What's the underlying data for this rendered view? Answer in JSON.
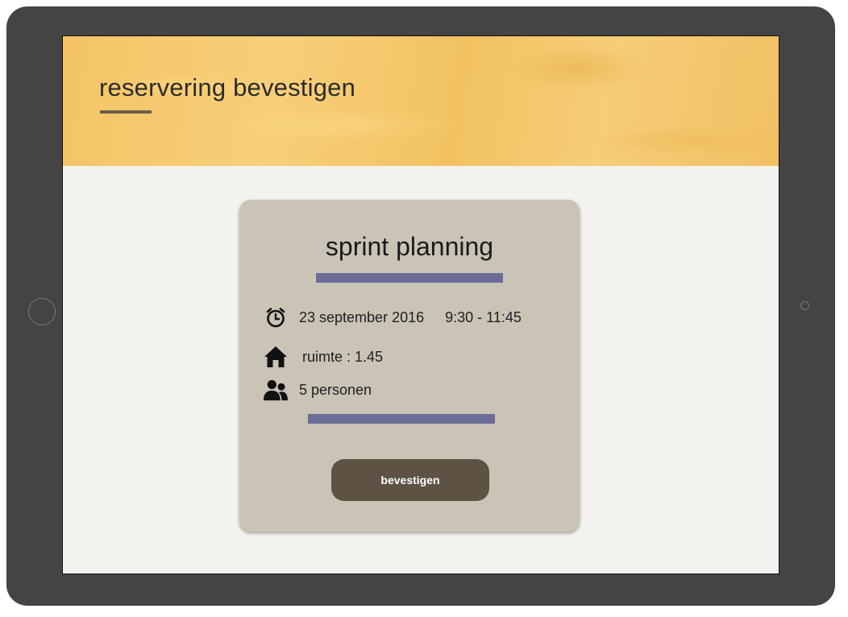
{
  "header": {
    "title": "reservering bevestigen",
    "background_color": "#f4c465",
    "underline_color": "#6b5d48"
  },
  "card": {
    "title": "sprint planning",
    "accent_color": "#6c6c98",
    "background_color": "#c9c4b5",
    "date": {
      "icon": "alarm-clock-icon",
      "label": "23 september 2016",
      "time": "9:30 - 11:45"
    },
    "room": {
      "icon": "home-icon",
      "label": "ruimte :  1.45"
    },
    "people": {
      "icon": "users-icon",
      "label": "5 personen"
    },
    "confirm_button": {
      "label": "bevestigen",
      "color": "#5e5245"
    }
  }
}
